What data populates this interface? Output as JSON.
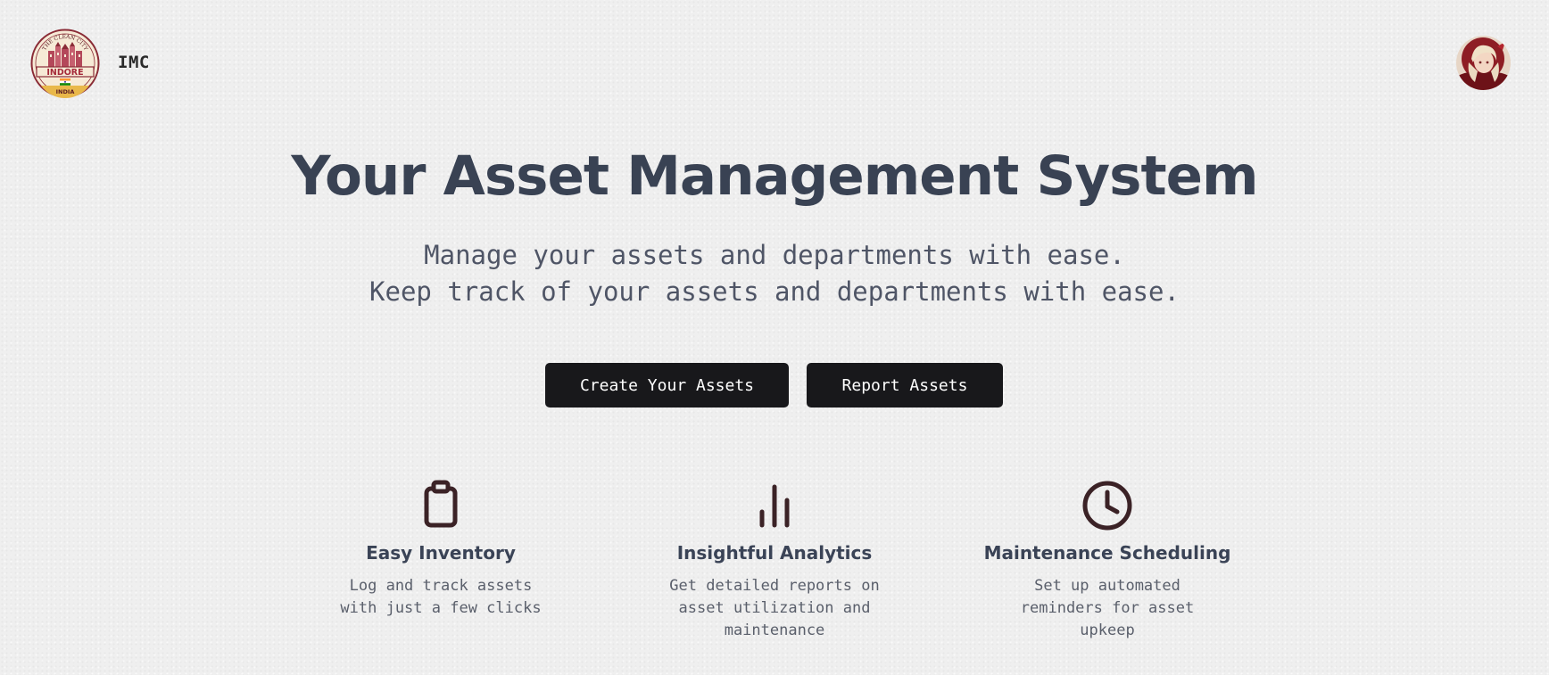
{
  "header": {
    "logo": {
      "top_text": "THE CLEAN CITY",
      "city": "INDORE",
      "country": "INDIA"
    },
    "brand": "IMC",
    "avatar_icon": "user-avatar"
  },
  "hero": {
    "title": "Your Asset Management System",
    "subtitle_line1": "Manage your assets and departments with ease.",
    "subtitle_line2": "Keep track of your assets and departments with ease."
  },
  "actions": {
    "create_label": "Create Your Assets",
    "report_label": "Report Assets"
  },
  "features": [
    {
      "icon": "clipboard-icon",
      "title": "Easy Inventory",
      "description": "Log and track assets with just a few clicks"
    },
    {
      "icon": "bar-chart-icon",
      "title": "Insightful Analytics",
      "description": "Get detailed reports on asset utilization and maintenance"
    },
    {
      "icon": "clock-icon",
      "title": "Maintenance Scheduling",
      "description": "Set up automated reminders for asset upkeep"
    }
  ],
  "colors": {
    "background": "#efefef",
    "title": "#394253",
    "button": "#18181b",
    "icon": "#3b2226"
  }
}
